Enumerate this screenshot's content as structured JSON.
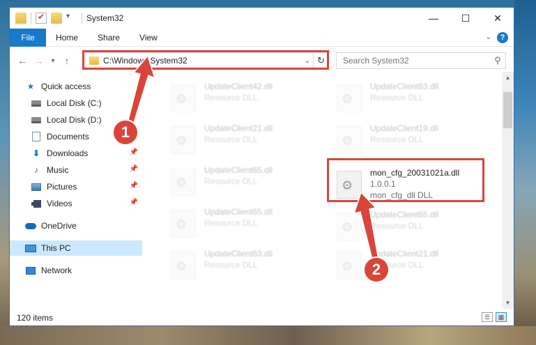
{
  "window": {
    "title": "System32"
  },
  "window_controls": {
    "minimize": "—",
    "maximize": "☐",
    "close": "✕"
  },
  "ribbon": {
    "tabs": [
      "File",
      "Home",
      "Share",
      "View"
    ]
  },
  "navigation": {
    "back": "←",
    "forward": "→",
    "recent": "▾",
    "up": "↑"
  },
  "address_bar": {
    "path": "C:\\Windows\\System32",
    "dropdown": "⌄",
    "refresh": "↻"
  },
  "search": {
    "placeholder": "Search System32"
  },
  "sidebar": {
    "items": [
      {
        "label": "Quick access",
        "icon": "star-icon"
      },
      {
        "label": "Local Disk (C:)",
        "icon": "drive-icon"
      },
      {
        "label": "Local Disk (D:)",
        "icon": "drive-icon"
      },
      {
        "label": "Documents",
        "icon": "documents-icon"
      },
      {
        "label": "Downloads",
        "icon": "downloads-icon"
      },
      {
        "label": "Music",
        "icon": "music-icon"
      },
      {
        "label": "Pictures",
        "icon": "pictures-icon"
      },
      {
        "label": "Videos",
        "icon": "videos-icon"
      },
      {
        "label": "OneDrive",
        "icon": "onedrive-icon"
      },
      {
        "label": "This PC",
        "icon": "this-pc-icon",
        "selected": true
      },
      {
        "label": "Network",
        "icon": "network-icon"
      }
    ]
  },
  "files": [
    {
      "name": "UpdateClient42.dll",
      "type": "Resource DLL"
    },
    {
      "name": "UpdateClient63.dll",
      "type": "Resource DLL"
    },
    {
      "name": "UpdateClient21.dll",
      "type": "Resource DLL"
    },
    {
      "name": "UpdateClient19.dll",
      "type": "Resource DLL"
    },
    {
      "name": "UpdateClient65.dll",
      "type": "Resource DLL"
    },
    {
      "name": "mon_cfg_20031021a.dll",
      "version": "1.0.0.1",
      "type": "mon_cfg_dll DLL"
    },
    {
      "name": "UpdateClient65.dll",
      "type": "Resource DLL"
    },
    {
      "name": "UpdateClient65.dll",
      "type": "Resource DLL"
    },
    {
      "name": "UpdateClient63.dll",
      "type": "Resource DLL"
    },
    {
      "name": "UpdateClient21.dll",
      "type": "Resource DLL"
    }
  ],
  "status_bar": {
    "item_count": "120 items"
  },
  "annotations": {
    "step1": "1",
    "step2": "2",
    "highlight_color": "#d9453b"
  },
  "colors": {
    "accent": "#1979ca",
    "selection": "#cce8ff"
  }
}
